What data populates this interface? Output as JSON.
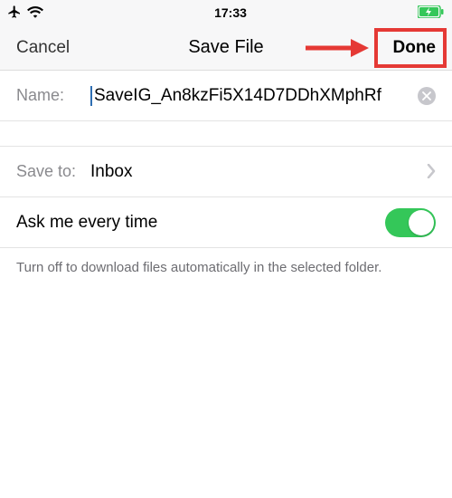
{
  "status": {
    "time": "17:33"
  },
  "nav": {
    "cancel": "Cancel",
    "title": "Save File",
    "done": "Done"
  },
  "name": {
    "label": "Name:",
    "value": "SaveIG_An8kzFi5X14D7DDhXMphRf"
  },
  "saveto": {
    "label": "Save to:",
    "value": "Inbox"
  },
  "toggle": {
    "label": "Ask me every time",
    "on": true
  },
  "footer": "Turn off to download files automatically in the selected folder."
}
